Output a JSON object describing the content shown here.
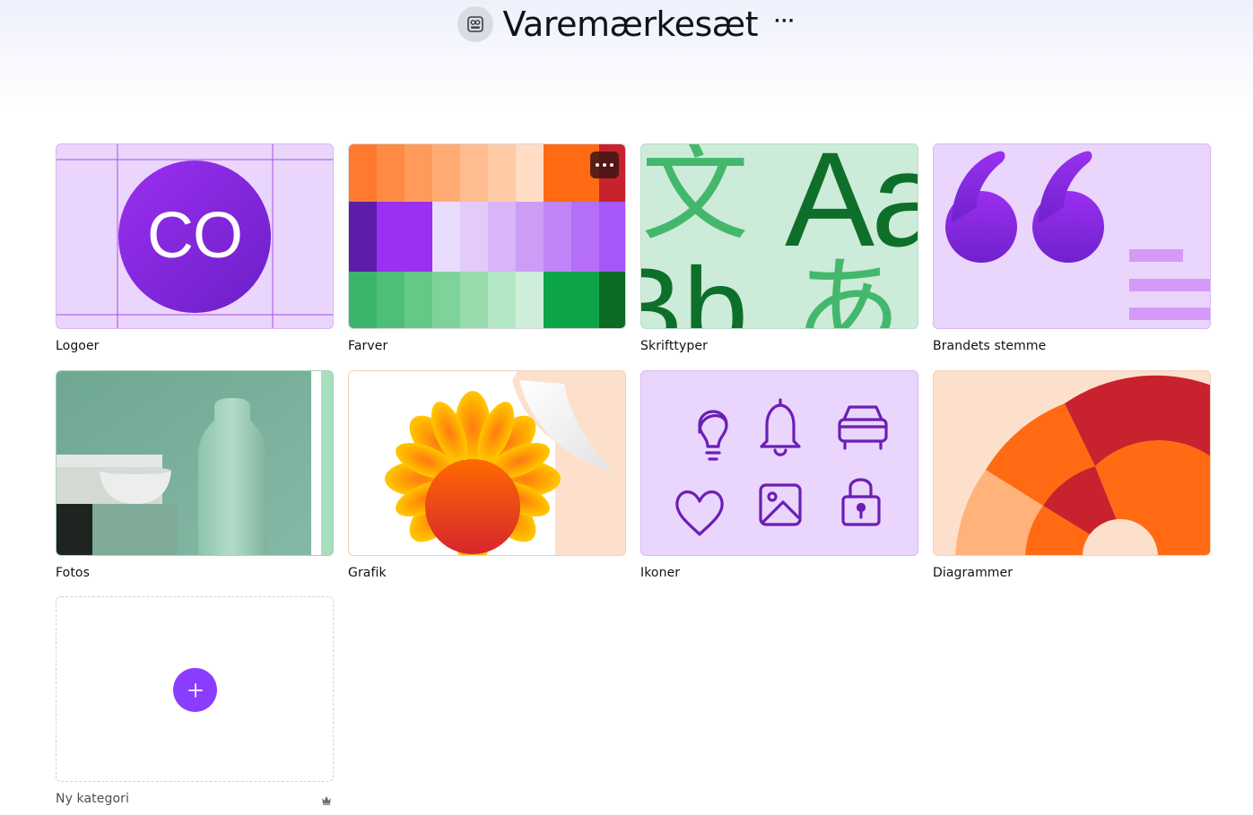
{
  "header": {
    "title": "Varemærkesæt",
    "brand_icon": "brand-kit-icon",
    "more_icon": "more-horizontal-icon"
  },
  "categories": [
    {
      "label": "Logoer",
      "logo_text": "CO"
    },
    {
      "label": "Farver"
    },
    {
      "label": "Skrifttyper",
      "glyphs": [
        "文",
        "Aa",
        "Bb",
        "あ"
      ]
    },
    {
      "label": "Brandets stemme"
    },
    {
      "label": "Fotos"
    },
    {
      "label": "Grafik"
    },
    {
      "label": "Ikoner",
      "icons": [
        "lightbulb-icon",
        "bell-icon",
        "car-icon",
        "heart-icon",
        "image-icon",
        "lock-icon"
      ]
    },
    {
      "label": "Diagrammer"
    }
  ],
  "new_category": {
    "label": "Ny kategori",
    "add_icon": "plus-icon",
    "premium_icon": "crown-icon"
  },
  "colors": {
    "accent": "#8b3dff",
    "lavender": "#ead5fd",
    "mint": "#cdebd9"
  }
}
